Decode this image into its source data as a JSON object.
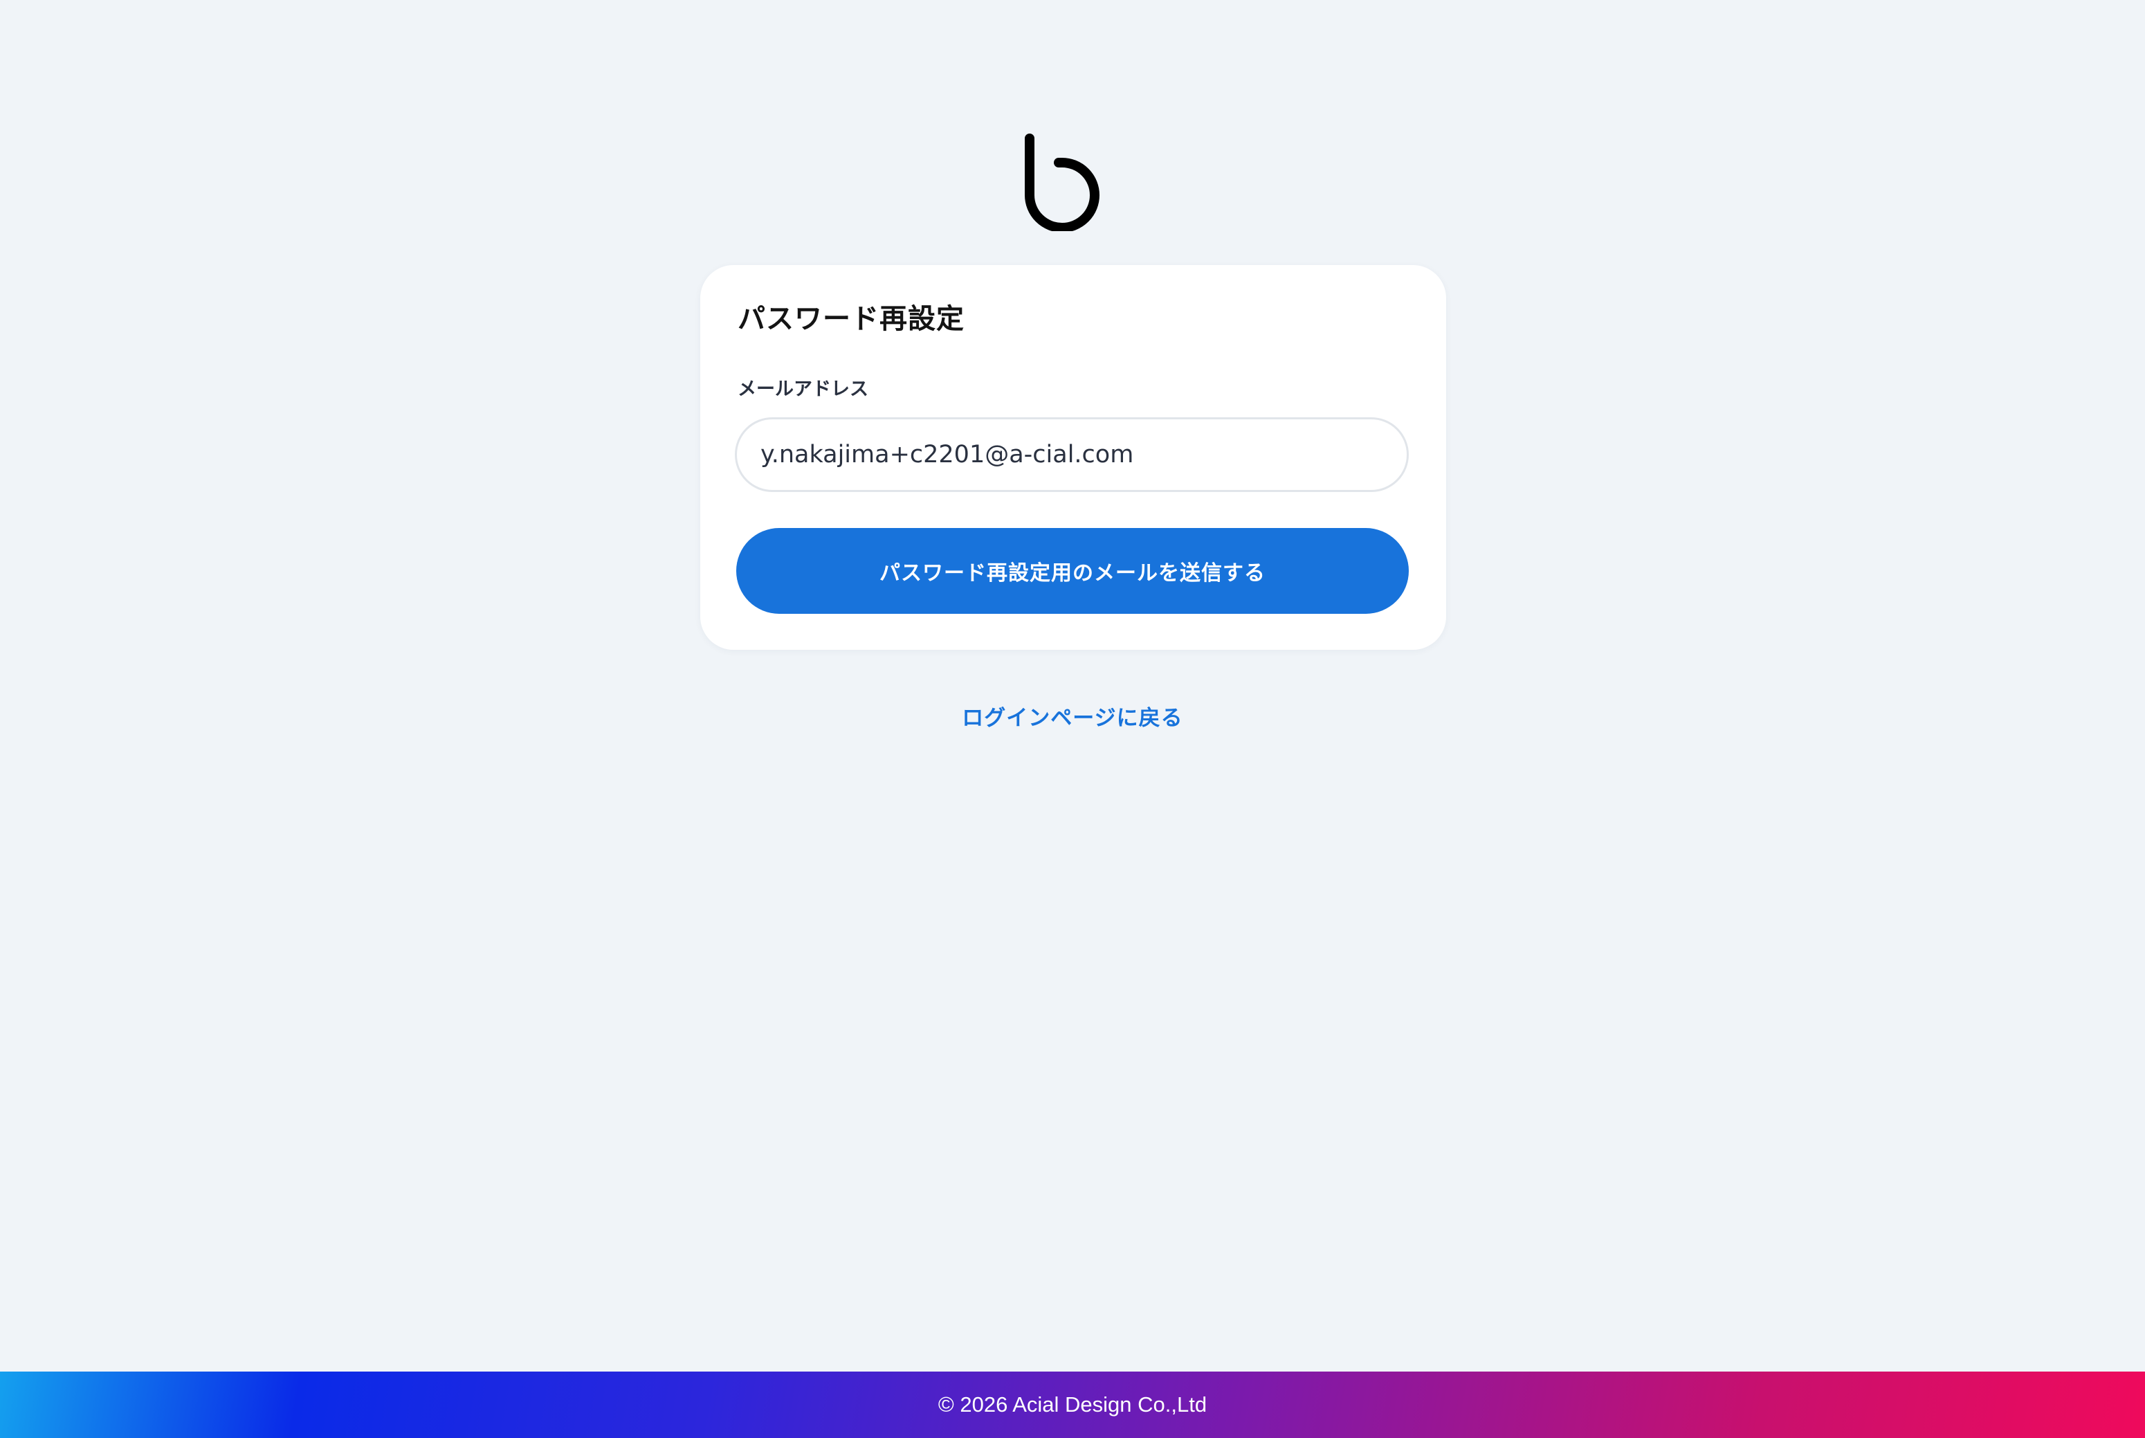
{
  "logo": {
    "icon": "b-plus-logo",
    "colors": [
      "#000000",
      "#0a2ae8",
      "#e3136a"
    ]
  },
  "reset_form": {
    "title": "パスワード再設定",
    "email_label": "メールアドレス",
    "email_value": "y.nakajima+c2201@a-cial.com",
    "submit_label": "パスワード再設定用のメールを送信する"
  },
  "back_link": {
    "label": "ログインページに戻る"
  },
  "footer": {
    "copyright": "© 2026 Acial Design Co.,Ltd"
  },
  "colors": {
    "background": "#f0f4f8",
    "accent": "#1873db",
    "card": "#ffffff"
  }
}
